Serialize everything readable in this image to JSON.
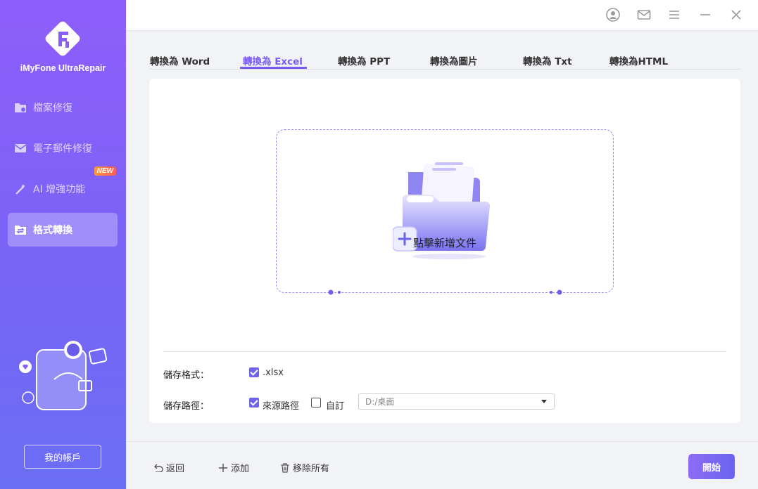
{
  "app": {
    "name": "iMyFone UltraRepair"
  },
  "sidebar": {
    "items": [
      {
        "label": "檔案修復",
        "icon": "file-repair-icon"
      },
      {
        "label": "電子郵件修復",
        "icon": "email-repair-icon"
      },
      {
        "label": "AI 增強功能",
        "icon": "ai-magic-icon",
        "badge": "NEW"
      },
      {
        "label": "格式轉換",
        "icon": "format-convert-icon",
        "active": true
      }
    ],
    "account_label": "我的帳戶"
  },
  "titlebar": {
    "icons": [
      "user-icon",
      "mail-icon",
      "menu-icon",
      "minimize-icon",
      "close-icon"
    ]
  },
  "tabs": [
    {
      "label": "轉換為 Word"
    },
    {
      "label": "轉換為 Excel",
      "active": true
    },
    {
      "label": "轉換為 PPT"
    },
    {
      "label": "轉換為圖片"
    },
    {
      "label": "轉換為 Txt"
    },
    {
      "label": "轉換為HTML"
    }
  ],
  "dropzone": {
    "label": "點擊新增文件"
  },
  "options": {
    "format_label": "儲存格式：",
    "format_value": ".xlsx",
    "format_checked": true,
    "path_label": "儲存路徑：",
    "source_path_label": "來源路徑",
    "source_path_checked": true,
    "custom_label": "自訂",
    "custom_checked": false,
    "path_value": "D:/桌面"
  },
  "bottom": {
    "back_label": "返回",
    "add_label": "添加",
    "remove_all_label": "移除所有",
    "start_label": "開始"
  },
  "colors": {
    "accent": "#7a5cf5",
    "sidebar_top": "#8f5dfb",
    "sidebar_bottom": "#6a6ef4"
  }
}
